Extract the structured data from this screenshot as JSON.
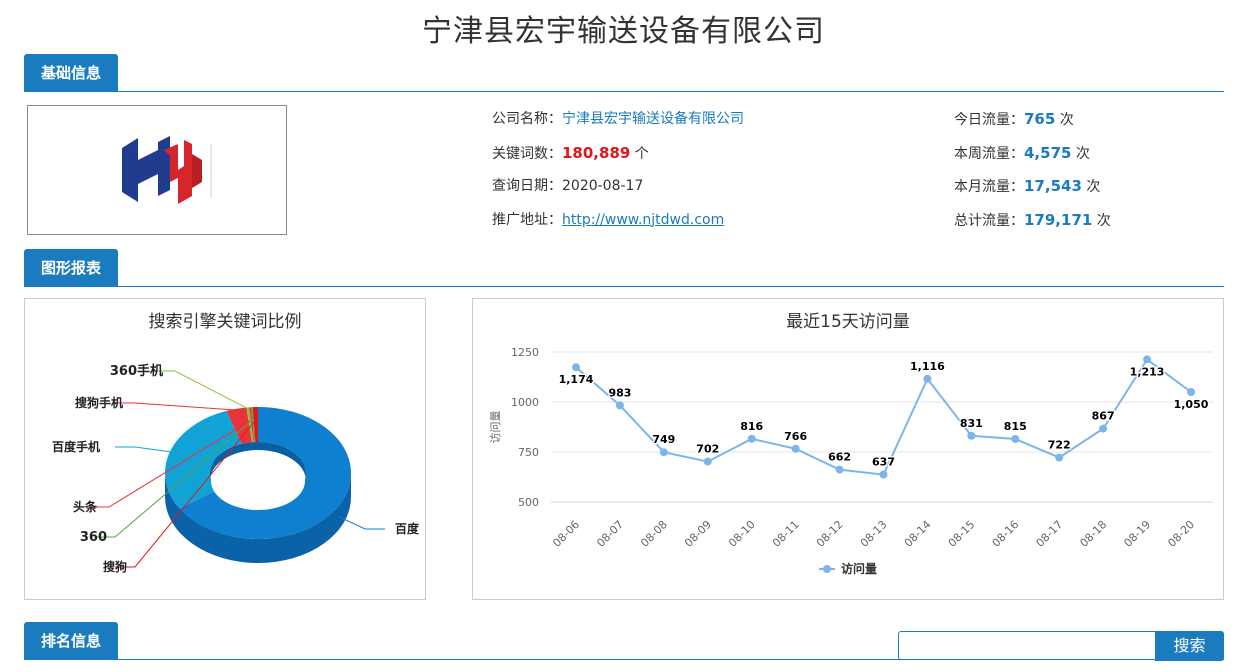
{
  "page_title": "宁津县宏宇输送设备有限公司",
  "sections": {
    "basic": "基础信息",
    "charts": "图形报表",
    "ranking": "排名信息"
  },
  "basic_info": {
    "company_label": "公司名称：",
    "company_name": "宁津县宏宇输送设备有限公司",
    "keywords_label": "关键词数：",
    "keywords_value": "180,889",
    "keywords_unit": "个",
    "query_date_label": "查询日期：",
    "query_date": "2020-08-17",
    "promo_label": "推广地址：",
    "promo_url": "http://www.njtdwd.com",
    "today_label": "今日流量：",
    "today_value": "765",
    "week_label": "本周流量：",
    "week_value": "4,575",
    "month_label": "本月流量：",
    "month_value": "17,543",
    "total_label": "总计流量：",
    "total_value": "179,171",
    "visits_unit": "次"
  },
  "search": {
    "placeholder": "",
    "button_label": "搜索"
  },
  "colors": {
    "accent": "#1a7bbf",
    "red": "#e0161b"
  },
  "chart_data": [
    {
      "type": "pie",
      "title": "搜索引擎关键词比例",
      "labels": [
        "百度",
        "百度手机",
        "搜狗手机",
        "360手机",
        "头条",
        "360",
        "搜狗"
      ],
      "values": [
        66.0,
        28.5,
        3.5,
        0.5,
        0.3,
        0.3,
        0.9
      ],
      "colors": [
        "#0f7fcf",
        "#12a3d6",
        "#e8333a",
        "#8ac43f",
        "#e8333a",
        "#51a845",
        "#e0161b"
      ]
    },
    {
      "type": "line",
      "title": "最近15天访问量",
      "ylabel": "访问量",
      "x": [
        "08-06",
        "08-07",
        "08-08",
        "08-09",
        "08-10",
        "08-11",
        "08-12",
        "08-13",
        "08-14",
        "08-15",
        "08-16",
        "08-17",
        "08-18",
        "08-19",
        "08-20"
      ],
      "series": [
        {
          "name": "访问量",
          "values": [
            1174,
            983,
            749,
            702,
            816,
            766,
            662,
            637,
            1116,
            831,
            815,
            722,
            867,
            1213,
            1050
          ]
        }
      ],
      "yticks": [
        500,
        750,
        1000,
        1250
      ],
      "ylim": [
        500,
        1250
      ],
      "data_labels": [
        "1,174",
        "983",
        "749",
        "702",
        "816",
        "766",
        "662",
        "637",
        "1,116",
        "831",
        "815",
        "722",
        "867",
        "1,213",
        "1,050"
      ],
      "line_color": "#7cb5ec"
    }
  ]
}
